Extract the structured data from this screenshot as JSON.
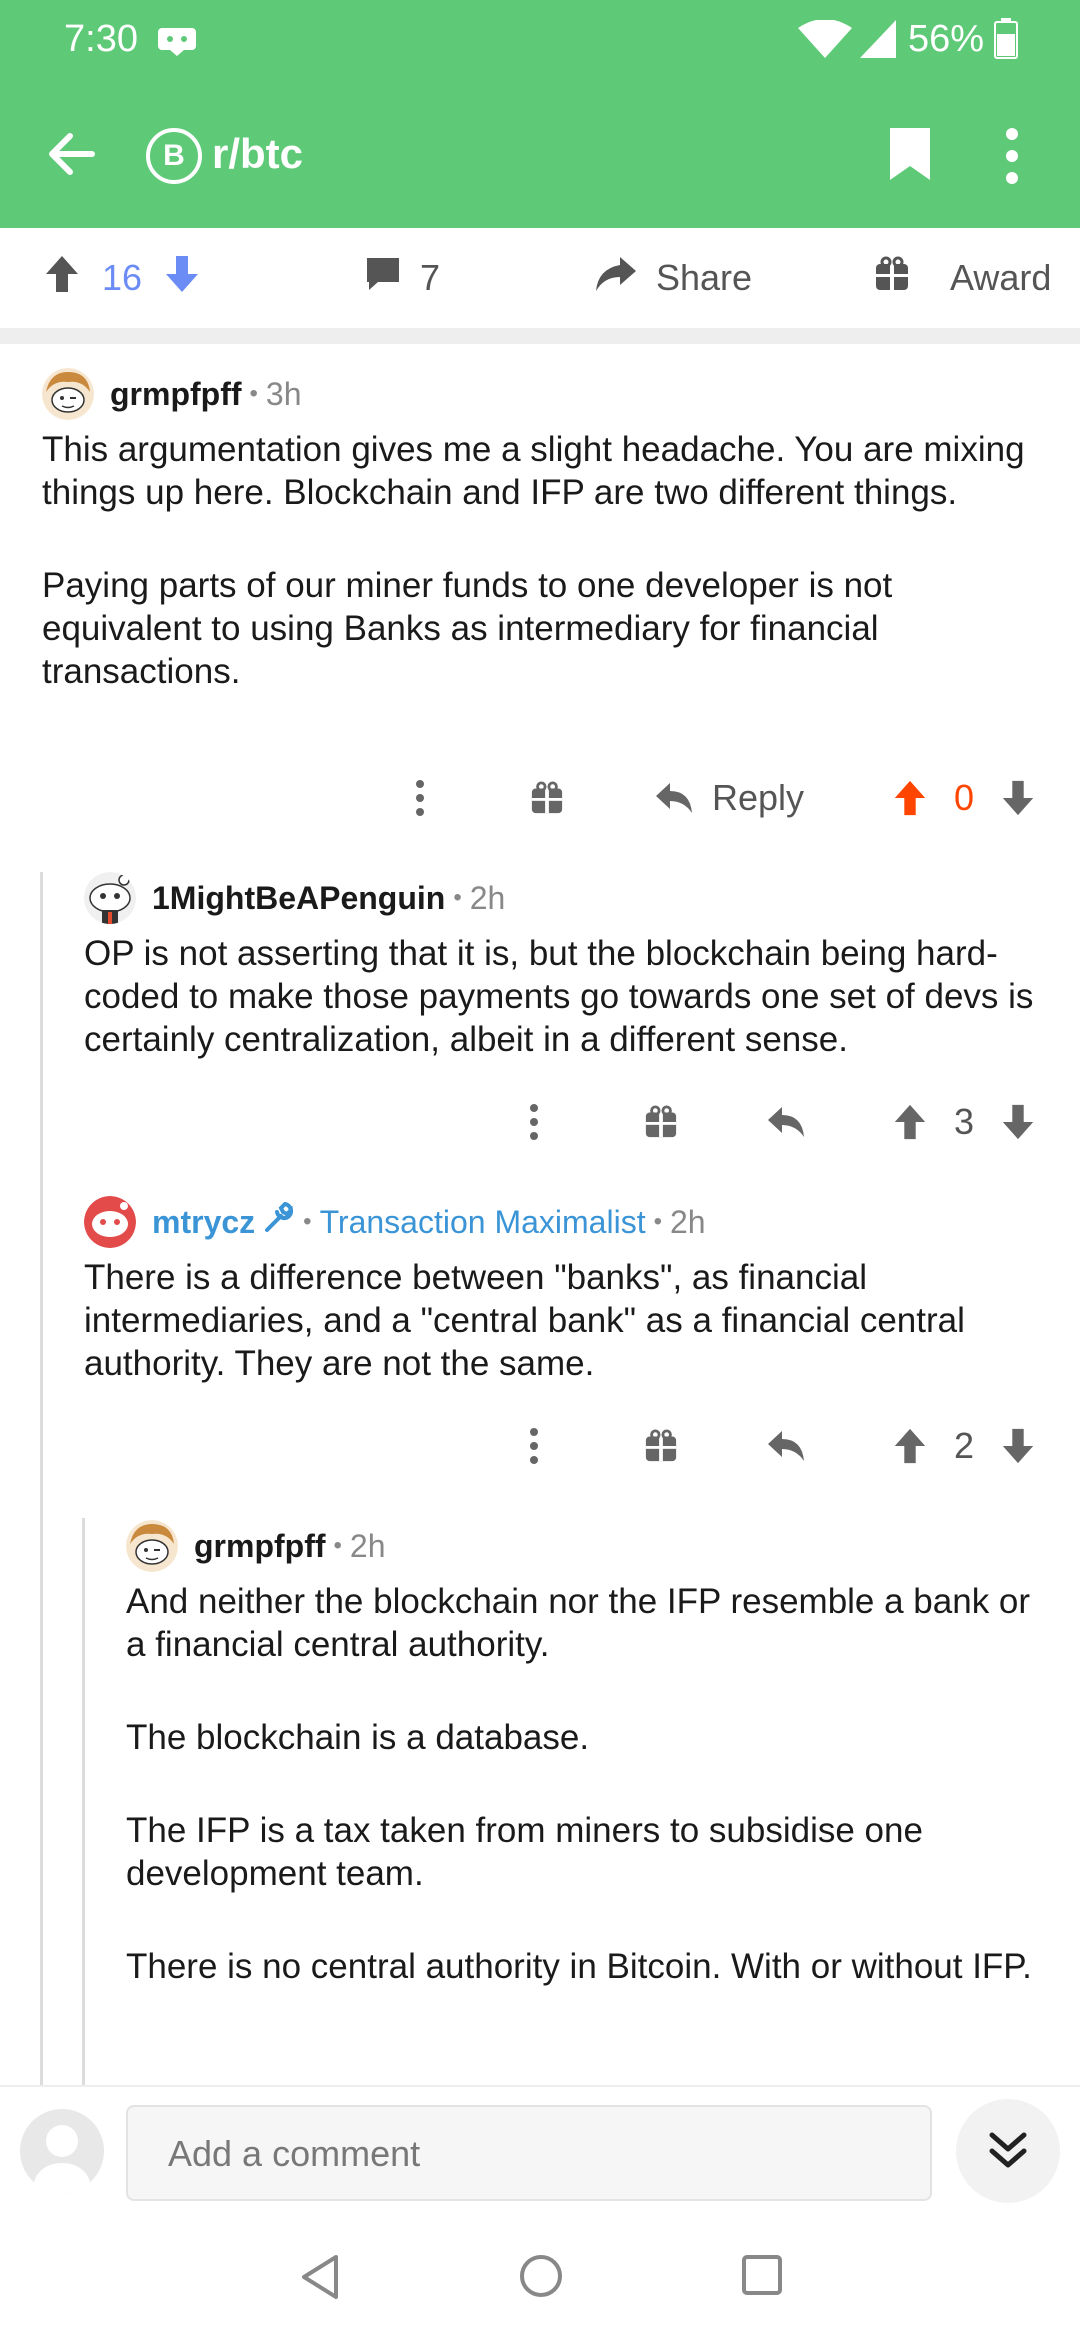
{
  "status_bar": {
    "time": "7:30",
    "battery": "56%"
  },
  "app_bar": {
    "subreddit_icon_glyph": "B",
    "subreddit": "r/btc"
  },
  "post_actions": {
    "score": "16",
    "comments": "7",
    "share": "Share",
    "award": "Award"
  },
  "comments": [
    {
      "author": "grmpfpff",
      "age": "3h",
      "body": [
        "This argumentation gives me a slight headache. You are mixing things up here. Blockchain and IFP are two different things.",
        "Paying parts of our miner funds to one developer is not equivalent to using Banks as intermediary for financial transactions."
      ],
      "reply_label": "Reply",
      "score": "0",
      "score_color": "#ff4500"
    },
    {
      "author": "1MightBeAPenguin",
      "age": "2h",
      "body": [
        "OP is not asserting that it is, but the blockchain being hard-coded to make those payments go towards one set of devs is certainly centralization, albeit in a different sense."
      ],
      "score": "3"
    },
    {
      "author": "mtrycz",
      "flair": "Transaction Maximalist",
      "age": "2h",
      "body": [
        "There is a difference between \"banks\", as financial intermediaries, and a \"central bank\" as a financial central authority. They are not the same."
      ],
      "score": "2"
    },
    {
      "author": "grmpfpff",
      "age": "2h",
      "body": [
        "And neither the blockchain nor the IFP resemble a bank or a financial central authority.",
        "The blockchain is a database.",
        "The IFP is a tax taken from miners to subsidise one development team.",
        "There is no central authority in Bitcoin. With or without IFP."
      ]
    }
  ],
  "composer": {
    "placeholder": "Add a comment"
  },
  "colors": {
    "brand": "#5ec977",
    "upvote_active": "#ff4500",
    "flair": "#3a94d6",
    "score": "#6c8cf5"
  },
  "icons": [
    "back-arrow-icon",
    "bookmark-icon",
    "more-vert-icon",
    "upvote-icon",
    "downvote-icon",
    "comment-icon",
    "share-icon",
    "gift-icon",
    "reply-icon",
    "mod-icon",
    "chevrons-down-icon"
  ]
}
